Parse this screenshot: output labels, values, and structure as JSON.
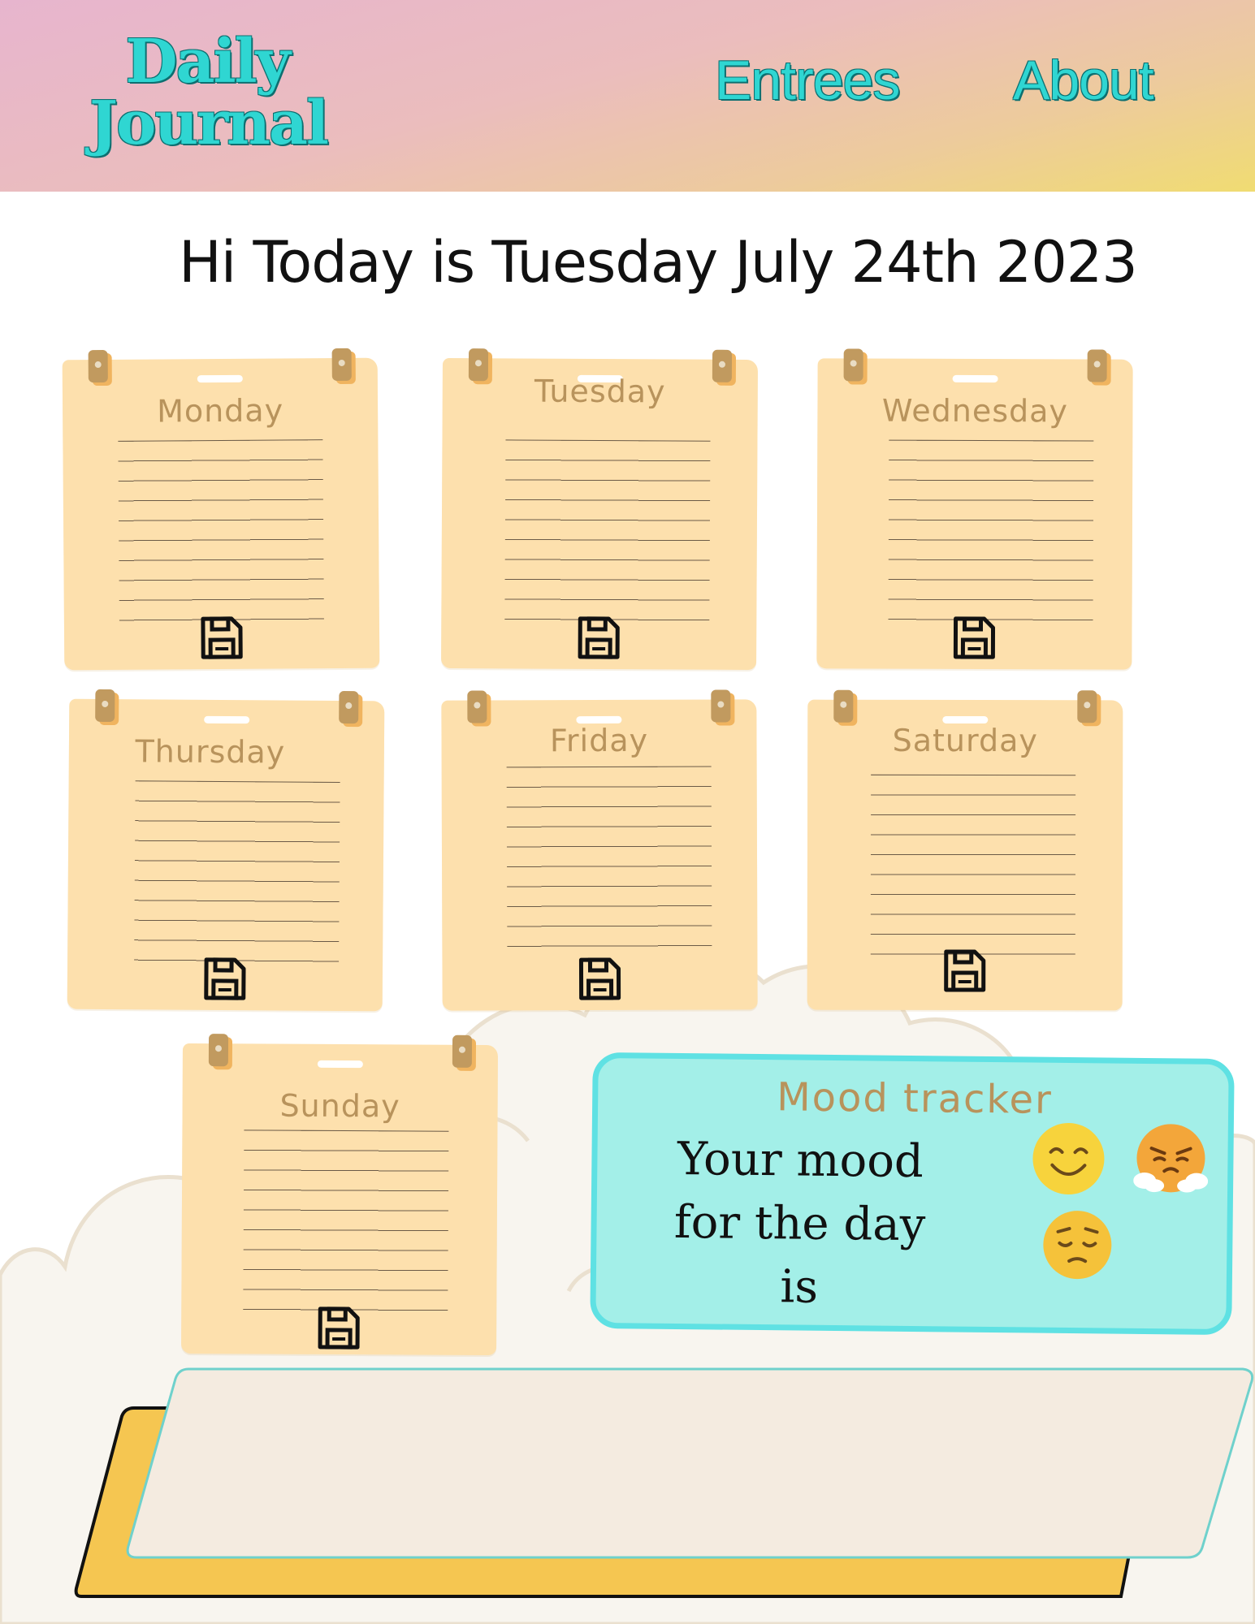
{
  "header": {
    "logo_line1": "Daily",
    "logo_line2": "Journal",
    "nav": {
      "entrees": "Entrees",
      "about": "About"
    }
  },
  "greeting": "Hi Today is Tuesday July 24th 2023",
  "days": {
    "monday": "Monday",
    "tuesday": "Tuesday",
    "wednesday": "Wednesday",
    "thursday": "Thursday",
    "friday": "Friday",
    "saturday": "Saturday",
    "sunday": "Sunday"
  },
  "icons": {
    "save": "floppy-disk-icon",
    "mood_happy": "smiling-face-icon",
    "mood_angry": "steaming-face-icon",
    "mood_sad": "pensive-face-icon"
  },
  "mood_tracker": {
    "title": "Mood tracker",
    "line1": "Your mood",
    "line2": "for the day",
    "line3": "is"
  },
  "colors": {
    "accent_teal": "#2fd6d2",
    "note_paper": "#fde0ad",
    "mood_panel": "#a3efe8",
    "panel_yellow": "#f5c651"
  }
}
